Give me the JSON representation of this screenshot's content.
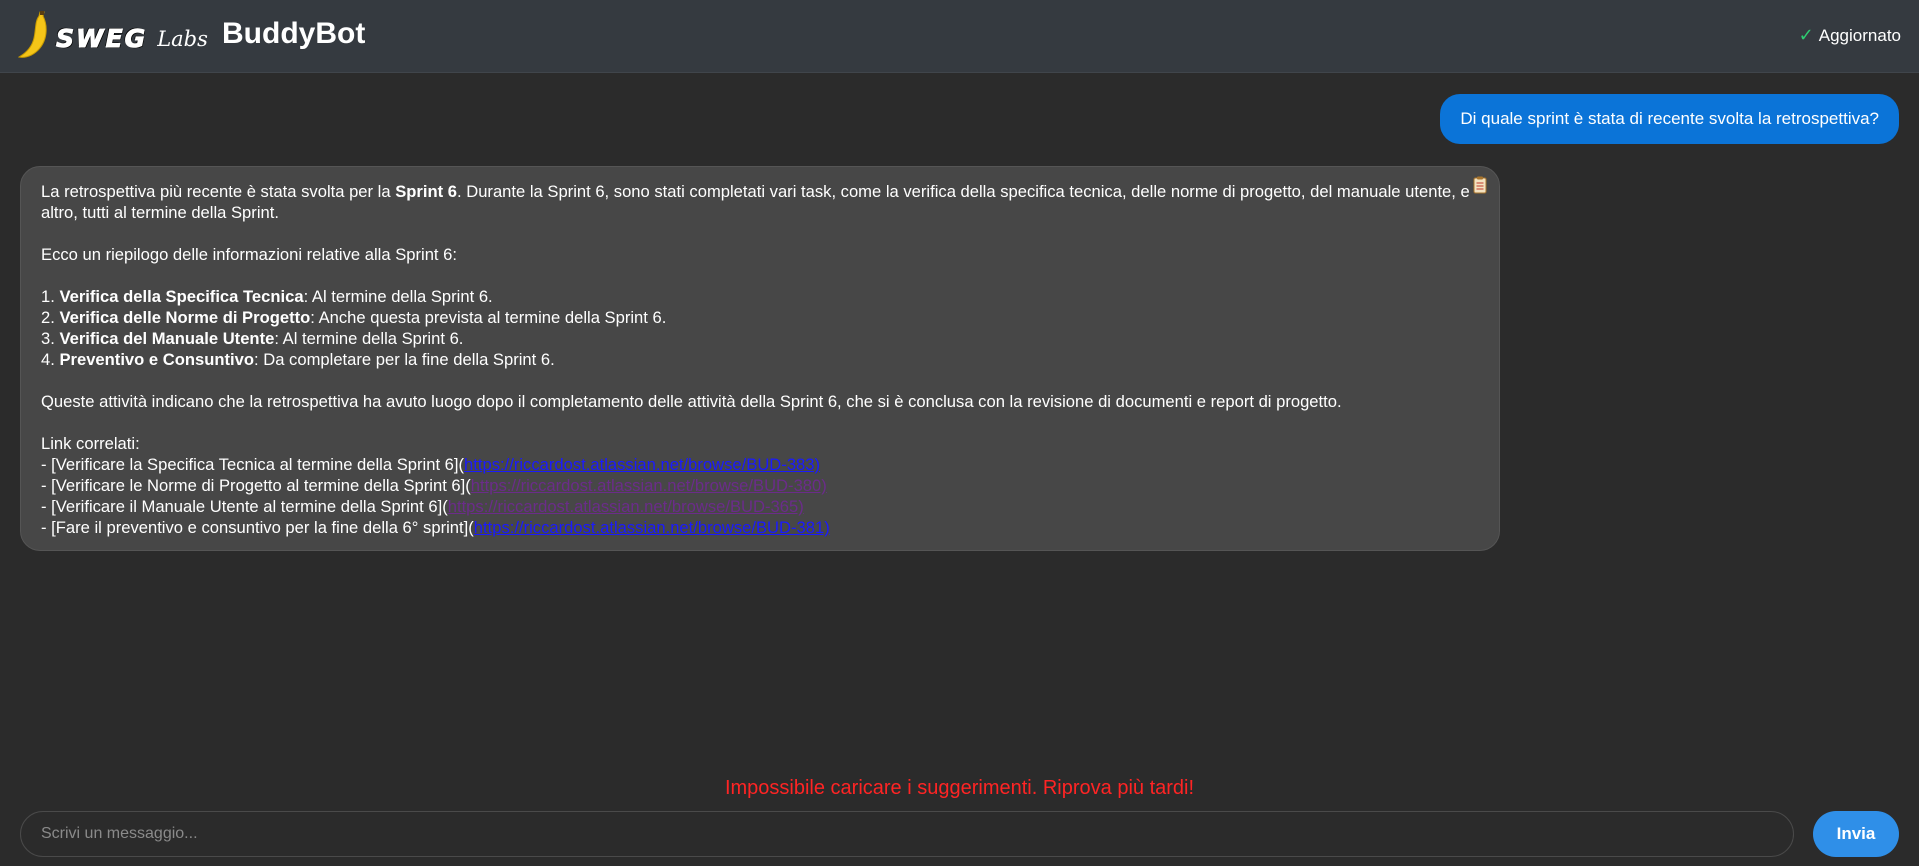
{
  "header": {
    "logo_text": "SWEG",
    "logo_sub": "Labs",
    "title": "BuddyBot",
    "status": "Aggiornato",
    "status_icon": "check-icon",
    "colors": {
      "header_bg": "#353a40",
      "status_check": "#2ecc71",
      "banana": "#f5c518"
    }
  },
  "conversation": {
    "user_message": "Di quale sprint è stata di recente svolta la retrospettiva?",
    "bot": {
      "copy_icon": "clipboard-icon",
      "intro_a": "La retrospettiva più recente è stata svolta per la ",
      "intro_bold": "Sprint 6",
      "intro_b": ". Durante la Sprint 6, sono stati completati vari task, come la verifica della specifica tecnica, delle norme di progetto, del manuale utente, e altro, tutti al termine della Sprint.",
      "summary_intro": "Ecco un riepilogo delle informazioni relative alla Sprint 6:",
      "items": [
        {
          "num": "1. ",
          "bold": "Verifica della Specifica Tecnica",
          "text": ": Al termine della Sprint 6."
        },
        {
          "num": "2. ",
          "bold": "Verifica delle Norme di Progetto",
          "text": ": Anche questa prevista al termine della Sprint 6."
        },
        {
          "num": "3. ",
          "bold": "Verifica del Manuale Utente",
          "text": ": Al termine della Sprint 6."
        },
        {
          "num": "4. ",
          "bold": "Preventivo e Consuntivo",
          "text": ": Da completare per la fine della Sprint 6."
        }
      ],
      "conclusion": "Queste attività indicano che la retrospettiva ha avuto luogo dopo il completamento delle attività della Sprint 6, che si è conclusa con la revisione di documenti e report di progetto.",
      "links_label": "Link correlati:",
      "links": [
        {
          "prefix": "- [Verificare la Specifica Tecnica al termine della Sprint 6](",
          "url": "https://riccardost.atlassian.net/browse/BUD-383)",
          "visited": false
        },
        {
          "prefix": "- [Verificare le Norme di Progetto al termine della Sprint 6](",
          "url": "https://riccardost.atlassian.net/browse/BUD-380)",
          "visited": true
        },
        {
          "prefix": "- [Verificare il Manuale Utente al termine della Sprint 6](",
          "url": "https://riccardost.atlassian.net/browse/BUD-365)",
          "visited": true
        },
        {
          "prefix": "- [Fare il preventivo e consuntivo per la fine della 6° sprint](",
          "url": "https://riccardost.atlassian.net/browse/BUD-381)",
          "visited": false
        }
      ]
    }
  },
  "footer": {
    "error": "Impossibile caricare i suggerimenti. Riprova più tardi!",
    "input_placeholder": "Scrivi un messaggio...",
    "send_label": "Invia",
    "colors": {
      "error": "#ff2424",
      "send": "#2f8fe8",
      "user_bubble": "#0b74d8"
    }
  }
}
